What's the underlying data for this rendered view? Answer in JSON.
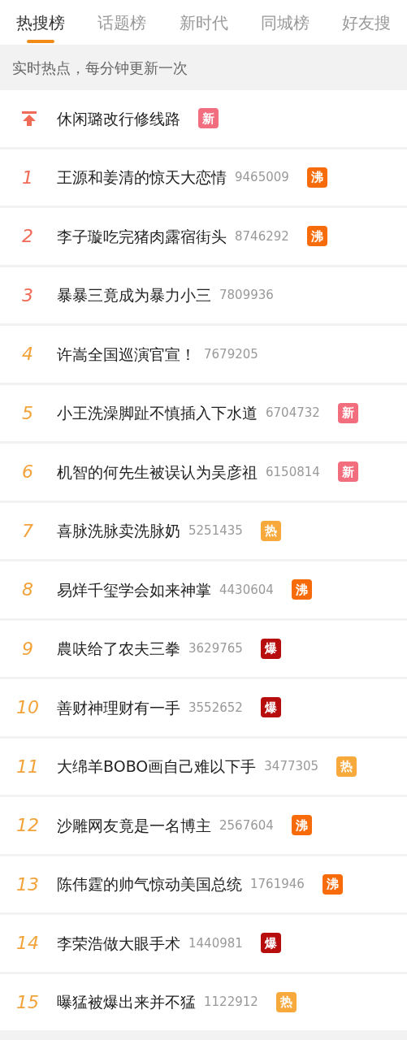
{
  "tabs": [
    {
      "label": "热搜榜",
      "selected": true
    },
    {
      "label": "话题榜",
      "selected": false
    },
    {
      "label": "新时代",
      "selected": false
    },
    {
      "label": "同城榜",
      "selected": false
    },
    {
      "label": "好友搜",
      "selected": false
    }
  ],
  "notice": "实时热点，每分钟更新一次",
  "items": [
    {
      "kind": "pinned",
      "title": "休闲璐改行修线路",
      "badge": {
        "label": "新",
        "color": "#f26d7d"
      }
    },
    {
      "kind": "ranked",
      "rank": "1",
      "color": "#ef6b57",
      "title": "王源和姜清的惊天大恋情",
      "count": "9465009",
      "badge": {
        "label": "沸",
        "color": "#f86b0a"
      }
    },
    {
      "kind": "ranked",
      "rank": "2",
      "color": "#ef6b57",
      "title": "李子璇吃完猪肉露宿街头",
      "count": "8746292",
      "badge": {
        "label": "沸",
        "color": "#f86b0a"
      }
    },
    {
      "kind": "ranked",
      "rank": "3",
      "color": "#ef6b57",
      "title": "暴暴三竟成为暴力小三",
      "count": "7809936"
    },
    {
      "kind": "ranked",
      "rank": "4",
      "color": "#f2a33a",
      "title": "许嵩全国巡演官宣！",
      "count": "7679205"
    },
    {
      "kind": "ranked",
      "rank": "5",
      "color": "#f2a33a",
      "title": "小王洗澡脚趾不慎插入下水道",
      "count": "6704732",
      "badge": {
        "label": "新",
        "color": "#f26d7d"
      }
    },
    {
      "kind": "ranked",
      "rank": "6",
      "color": "#f2a33a",
      "title": "机智的何先生被误认为吴彦祖",
      "count": "6150814",
      "badge": {
        "label": "新",
        "color": "#f26d7d"
      }
    },
    {
      "kind": "ranked",
      "rank": "7",
      "color": "#f2a33a",
      "title": "喜脉洗脉卖洗脉奶",
      "count": "5251435",
      "badge": {
        "label": "热",
        "color": "#f7a93b"
      }
    },
    {
      "kind": "ranked",
      "rank": "8",
      "color": "#f2a33a",
      "title": "易烊千玺学会如来神掌",
      "count": "4430604",
      "badge": {
        "label": "沸",
        "color": "#f86b0a"
      }
    },
    {
      "kind": "ranked",
      "rank": "9",
      "color": "#f2a33a",
      "title": "農呋给了农夫三拳",
      "count": "3629765",
      "badge": {
        "label": "爆",
        "color": "#b70d0d"
      }
    },
    {
      "kind": "ranked",
      "rank": "10",
      "color": "#f2a33a",
      "title": "善财神理财有一手",
      "count": "3552652",
      "badge": {
        "label": "爆",
        "color": "#b70d0d"
      }
    },
    {
      "kind": "ranked",
      "rank": "11",
      "color": "#f2a33a",
      "title": "大绵羊BOBO画自己难以下手",
      "count": "3477305",
      "badge": {
        "label": "热",
        "color": "#f7a93b"
      }
    },
    {
      "kind": "ranked",
      "rank": "12",
      "color": "#f2a33a",
      "title": "沙雕网友竟是一名博主",
      "count": "2567604",
      "badge": {
        "label": "沸",
        "color": "#f86b0a"
      }
    },
    {
      "kind": "ranked",
      "rank": "13",
      "color": "#f2a33a",
      "title": "陈伟霆的帅气惊动美国总统",
      "count": "1761946",
      "badge": {
        "label": "沸",
        "color": "#f86b0a"
      }
    },
    {
      "kind": "ranked",
      "rank": "14",
      "color": "#f2a33a",
      "title": "李荣浩做大眼手术",
      "count": "1440981",
      "badge": {
        "label": "爆",
        "color": "#b70d0d"
      }
    },
    {
      "kind": "ranked",
      "rank": "15",
      "color": "#f2a33a",
      "title": "曝猛被爆出来并不猛",
      "count": "1122912",
      "badge": {
        "label": "热",
        "color": "#f7a93b"
      }
    }
  ]
}
